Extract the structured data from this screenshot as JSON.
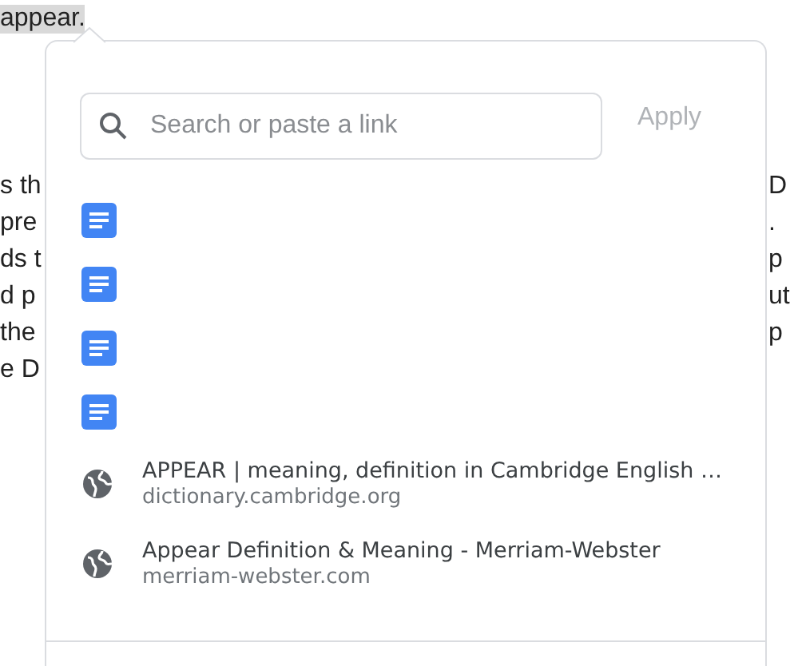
{
  "document": {
    "selected_word": "appear.",
    "lines": [
      {
        "left": "s th",
        "right": "D"
      },
      {
        "left": "pre",
        "right": "."
      },
      {
        "left": "ds t",
        "right": "p"
      },
      {
        "left": "d p",
        "right": "ut"
      },
      {
        "left": "the",
        "right": "p"
      },
      {
        "left": "e D"
      }
    ]
  },
  "link_popup": {
    "search": {
      "placeholder": "Search or paste a link"
    },
    "apply_button": {
      "label": "Apply",
      "disabled": true
    },
    "results": [
      {
        "kind": "doc"
      },
      {
        "kind": "doc"
      },
      {
        "kind": "doc"
      },
      {
        "kind": "doc"
      },
      {
        "kind": "web",
        "title": "APPEAR | meaning, definition in Cambridge English …",
        "url": "dictionary.cambridge.org"
      },
      {
        "kind": "web",
        "title": "Appear Definition & Meaning - Merriam-Webster",
        "url": "merriam-webster.com"
      }
    ]
  }
}
